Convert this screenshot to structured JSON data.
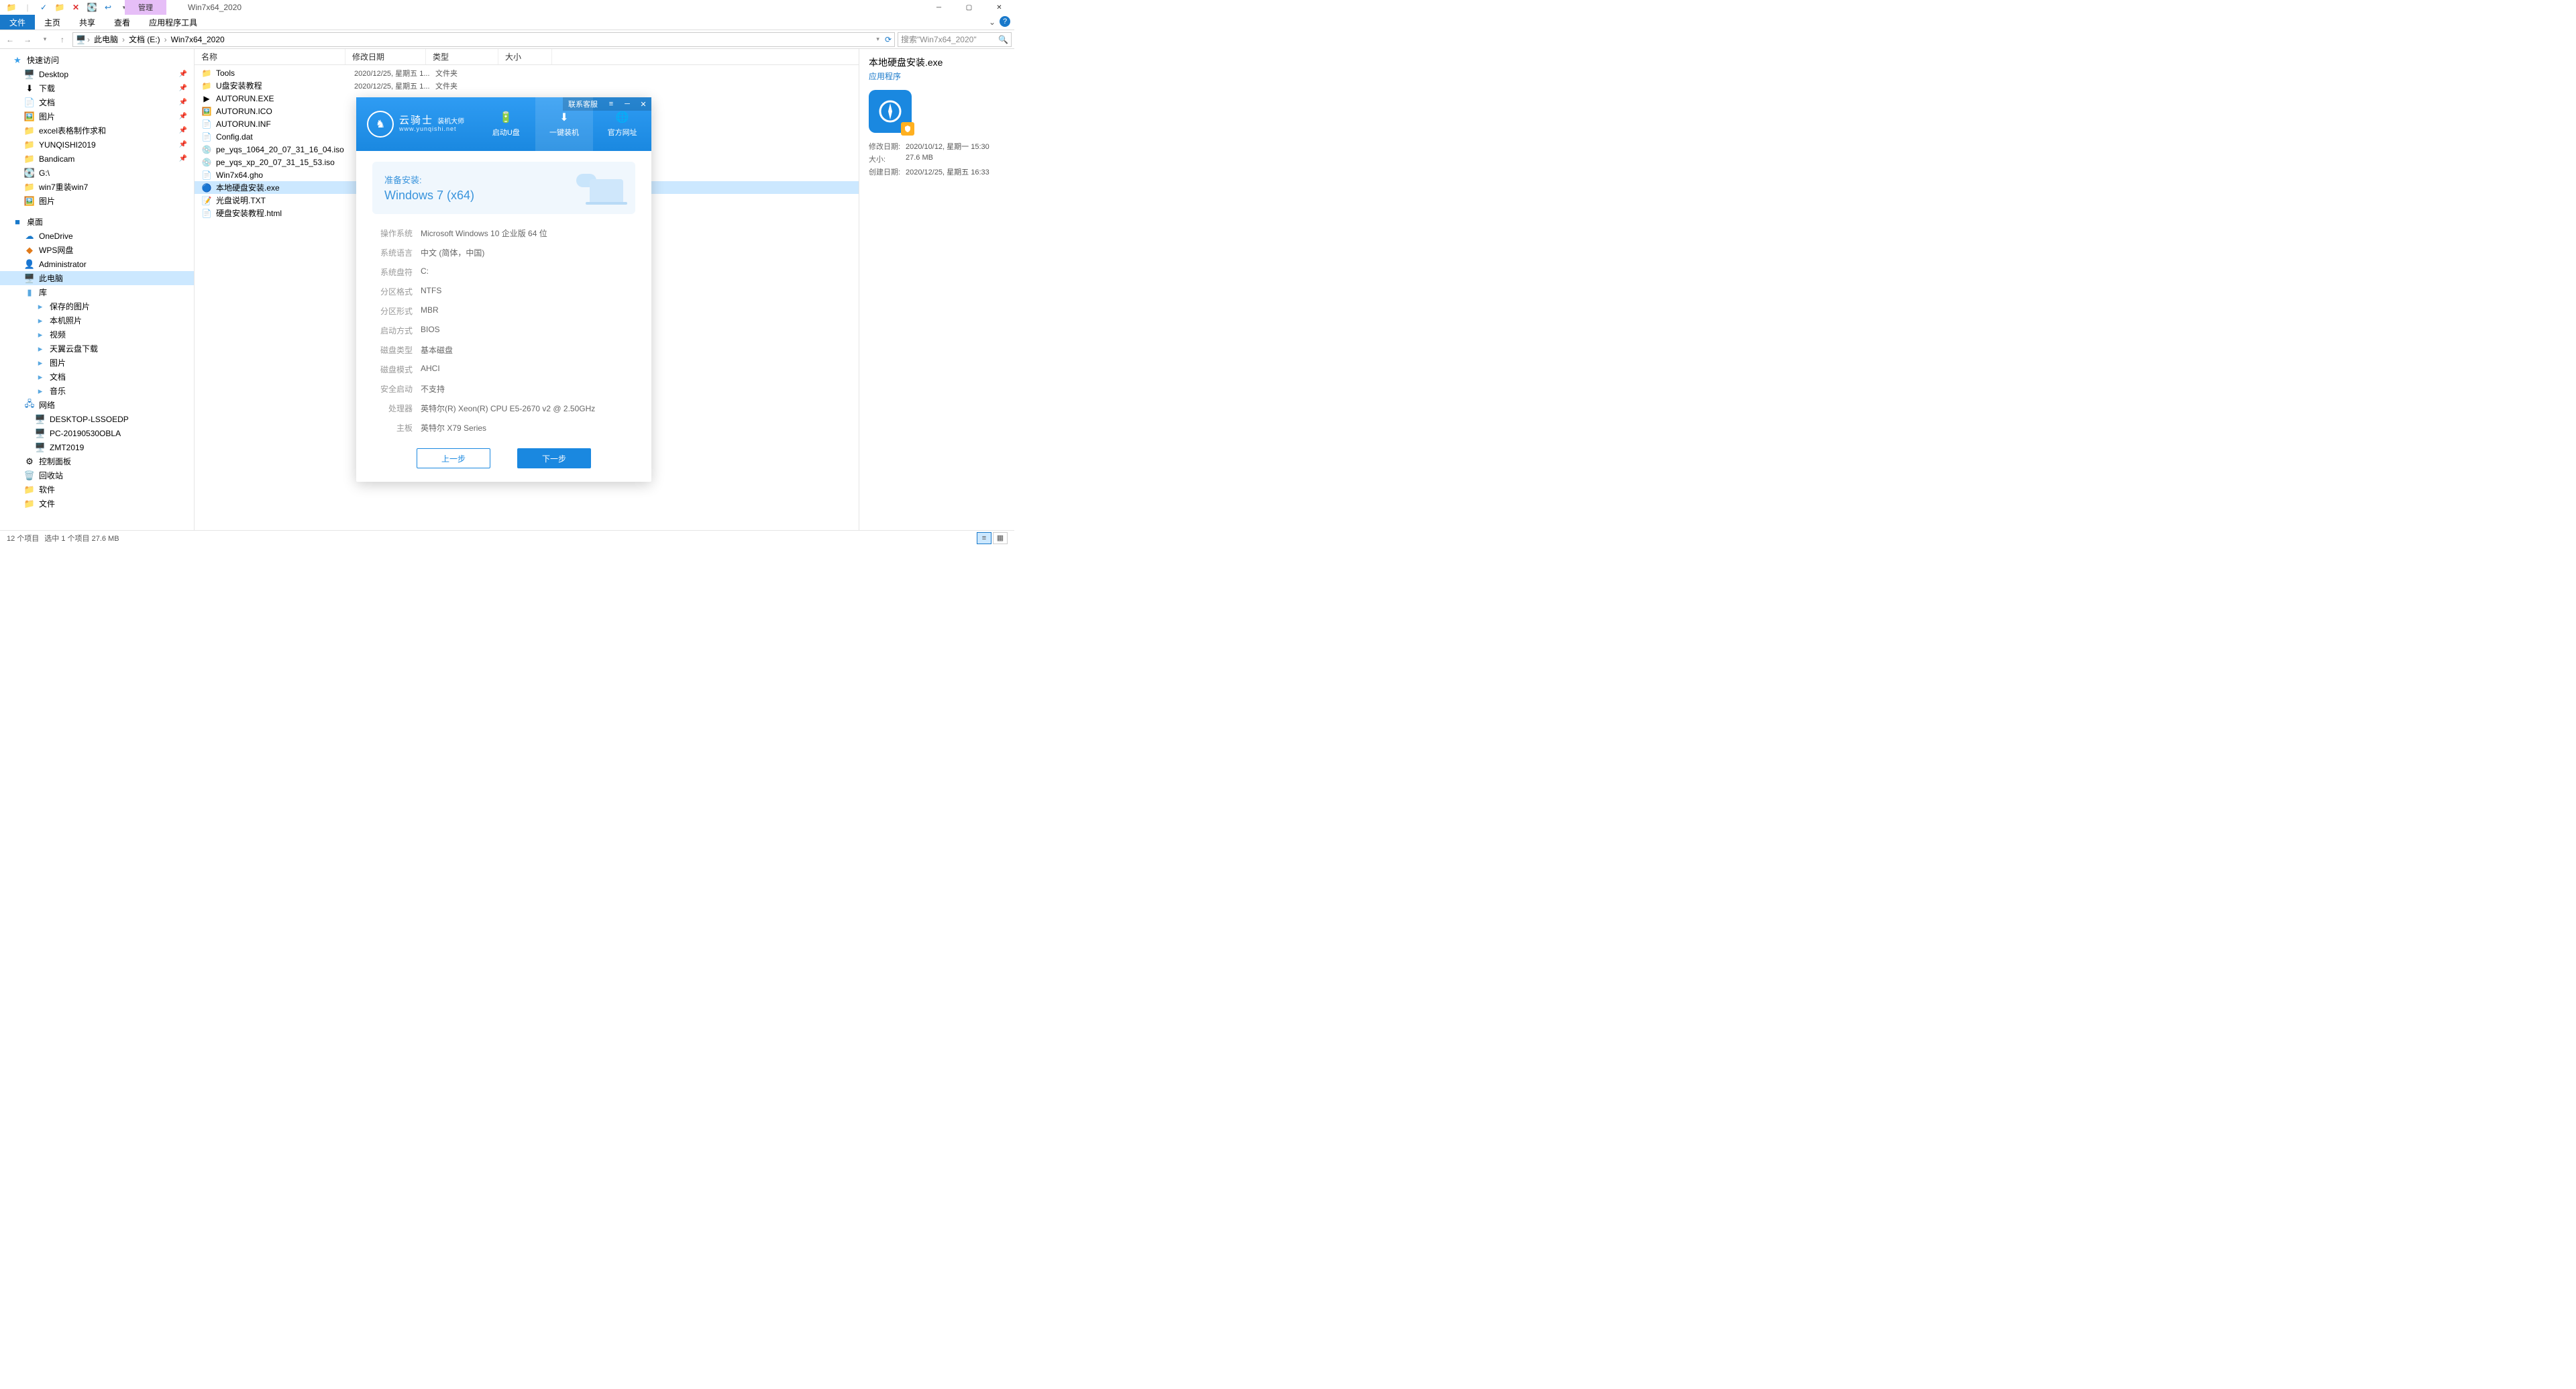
{
  "titlebar": {
    "tool_tab": "管理",
    "title": "Win7x64_2020"
  },
  "ribbon": {
    "file": "文件",
    "home": "主页",
    "share": "共享",
    "view": "查看",
    "apptools": "应用程序工具"
  },
  "address": {
    "crumbs": [
      "此电脑",
      "文档 (E:)",
      "Win7x64_2020"
    ],
    "search_placeholder": "搜索\"Win7x64_2020\""
  },
  "nav": {
    "quick": "快速访问",
    "quick_items": [
      "Desktop",
      "下载",
      "文档",
      "图片",
      "excel表格制作求和",
      "YUNQISHI2019",
      "Bandicam",
      "G:\\",
      "win7重装win7",
      "图片"
    ],
    "desktop": "桌面",
    "desktop_items": [
      "OneDrive",
      "WPS网盘",
      "Administrator",
      "此电脑",
      "库"
    ],
    "lib_items": [
      "保存的图片",
      "本机照片",
      "视频",
      "天翼云盘下载",
      "图片",
      "文档",
      "音乐"
    ],
    "network": "网络",
    "network_items": [
      "DESKTOP-LSSOEDP",
      "PC-20190530OBLA",
      "ZMT2019"
    ],
    "cp": "控制面板",
    "recycle": "回收站",
    "soft": "软件",
    "files": "文件"
  },
  "columns": {
    "name": "名称",
    "date": "修改日期",
    "type": "类型",
    "size": "大小"
  },
  "files": [
    {
      "icon": "folder",
      "name": "Tools",
      "date": "2020/12/25, 星期五 1...",
      "type": "文件夹"
    },
    {
      "icon": "folder",
      "name": "U盘安装教程",
      "date": "2020/12/25, 星期五 1...",
      "type": "文件夹"
    },
    {
      "icon": "exe-green",
      "name": "AUTORUN.EXE",
      "date": "",
      "type": ""
    },
    {
      "icon": "ico",
      "name": "AUTORUN.ICO",
      "date": "",
      "type": ""
    },
    {
      "icon": "inf",
      "name": "AUTORUN.INF",
      "date": "",
      "type": ""
    },
    {
      "icon": "dat",
      "name": "Config.dat",
      "date": "",
      "type": ""
    },
    {
      "icon": "iso",
      "name": "pe_yqs_1064_20_07_31_16_04.iso",
      "date": "",
      "type": ""
    },
    {
      "icon": "iso",
      "name": "pe_yqs_xp_20_07_31_15_53.iso",
      "date": "",
      "type": ""
    },
    {
      "icon": "gho",
      "name": "Win7x64.gho",
      "date": "",
      "type": ""
    },
    {
      "icon": "exe-blue",
      "name": "本地硬盘安装.exe",
      "date": "",
      "type": "",
      "selected": true
    },
    {
      "icon": "txt",
      "name": "光盘说明.TXT",
      "date": "",
      "type": ""
    },
    {
      "icon": "html",
      "name": "硬盘安装教程.html",
      "date": "",
      "type": ""
    }
  ],
  "details": {
    "title": "本地硬盘安装.exe",
    "subtitle": "应用程序",
    "meta": [
      {
        "k": "修改日期:",
        "v": "2020/10/12, 星期一 15:30"
      },
      {
        "k": "大小:",
        "v": "27.6 MB"
      },
      {
        "k": "创建日期:",
        "v": "2020/12/25, 星期五 16:33"
      }
    ]
  },
  "status": {
    "items": "12 个项目",
    "selected": "选中 1 个项目  27.6 MB"
  },
  "dialog": {
    "contact": "联系客服",
    "logo_name": "云骑士",
    "logo_sub": "装机大师",
    "logo_url": "www.yunqishi.net",
    "tabs": [
      "启动U盘",
      "一键装机",
      "官方网址"
    ],
    "hero_t1": "准备安装:",
    "hero_t2": "Windows 7 (x64)",
    "rows": [
      {
        "k": "操作系统",
        "v": "Microsoft Windows 10 企业版 64 位"
      },
      {
        "k": "系统语言",
        "v": "中文 (简体，中国)"
      },
      {
        "k": "系统盘符",
        "v": "C:"
      },
      {
        "k": "分区格式",
        "v": "NTFS"
      },
      {
        "k": "分区形式",
        "v": "MBR"
      },
      {
        "k": "启动方式",
        "v": "BIOS"
      },
      {
        "k": "磁盘类型",
        "v": "基本磁盘"
      },
      {
        "k": "磁盘模式",
        "v": "AHCI"
      },
      {
        "k": "安全启动",
        "v": "不支持"
      },
      {
        "k": "处理器",
        "v": "英特尔(R) Xeon(R) CPU E5-2670 v2 @ 2.50GHz"
      },
      {
        "k": "主板",
        "v": "英特尔 X79 Series"
      }
    ],
    "prev": "上一步",
    "next": "下一步"
  }
}
